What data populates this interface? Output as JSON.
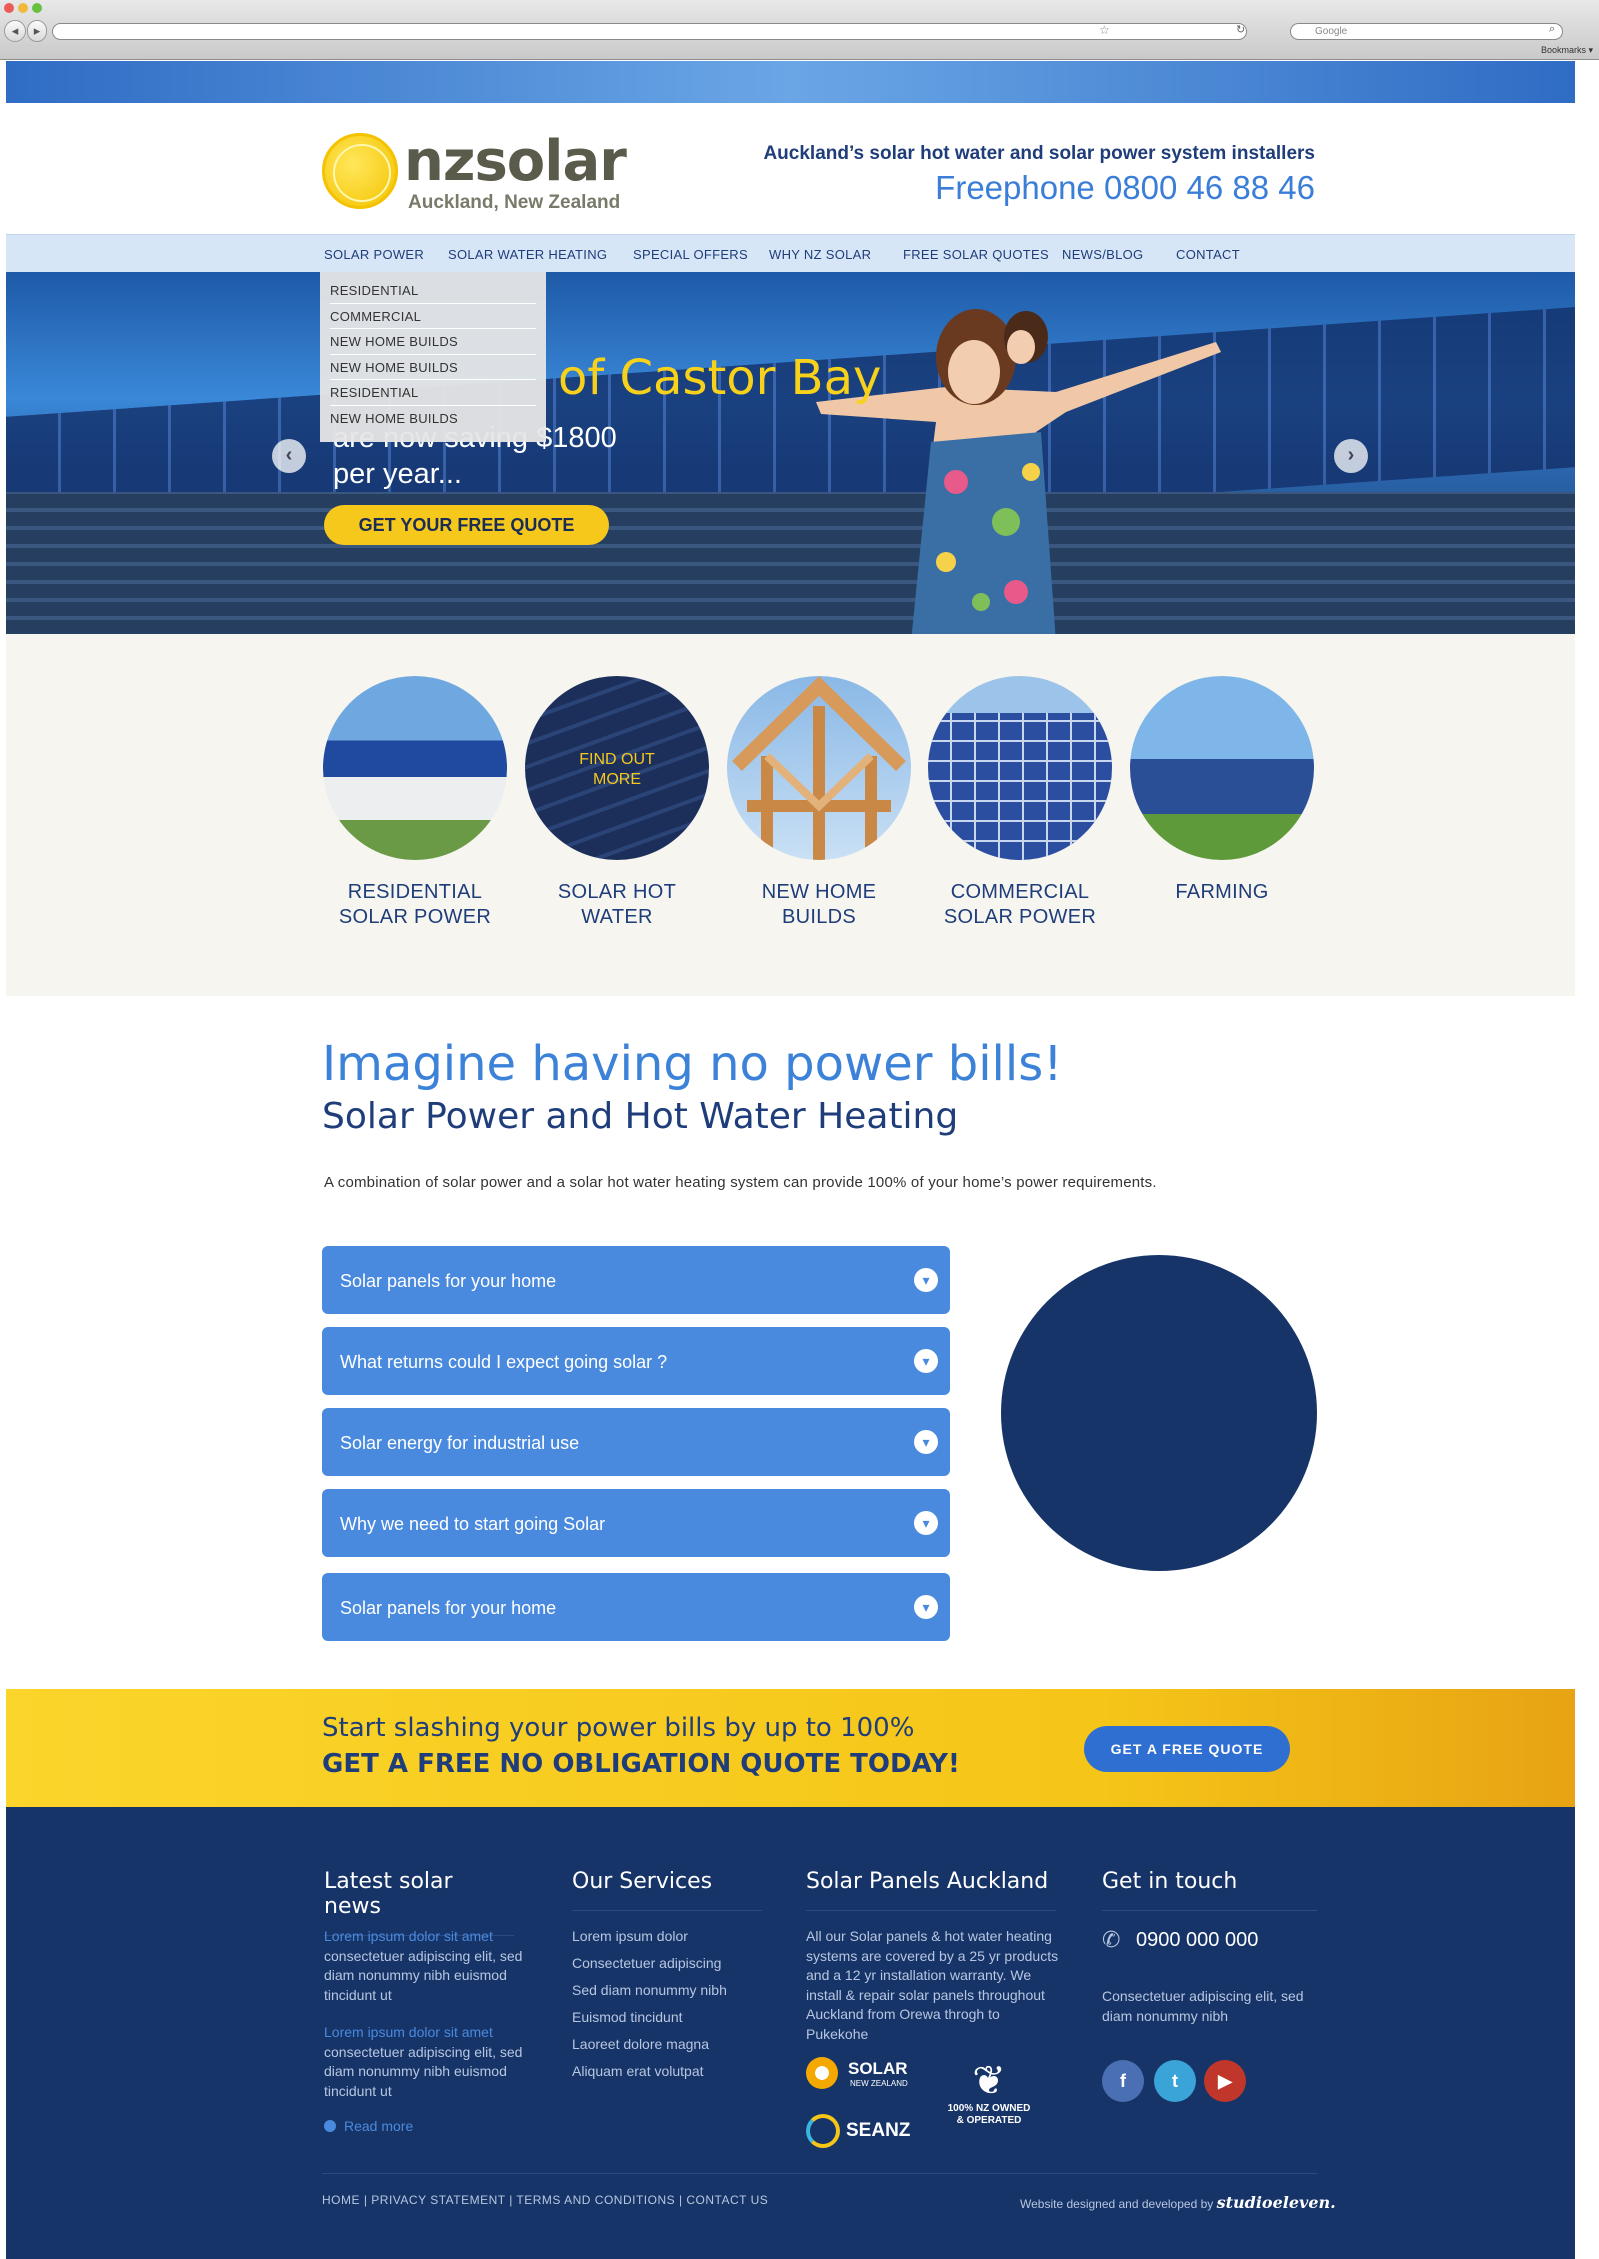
{
  "browser": {
    "url": "",
    "search_placeholder": "Google",
    "bookmarks_label": "Bookmarks"
  },
  "header": {
    "logo_name": "nzsolar",
    "logo_sub": "Auckland, New Zealand",
    "tagline": "Auckland’s solar hot water and solar power system installers",
    "phone": "Freephone 0800 46 88 46"
  },
  "nav": {
    "items": [
      "SOLAR POWER",
      "SOLAR WATER HEATING",
      "SPECIAL OFFERS",
      "WHY NZ SOLAR",
      "FREE SOLAR QUOTES",
      "NEWS/BLOG",
      "CONTACT"
    ],
    "dropdown": [
      "RESIDENTIAL",
      "COMMERCIAL",
      "NEW HOME BUILDS",
      "NEW HOME BUILDS",
      "RESIDENTIAL",
      "NEW HOME BUILDS"
    ]
  },
  "hero": {
    "title": "of Castor Bay",
    "line2": "are now saving $1800",
    "line3": "per year...",
    "button": "GET YOUR FREE QUOTE"
  },
  "categories": [
    {
      "label1": "RESIDENTIAL",
      "label2": "SOLAR POWER"
    },
    {
      "label1": "SOLAR HOT",
      "label2": "WATER",
      "overlay": "FIND OUT MORE"
    },
    {
      "label1": "NEW HOME",
      "label2": "BUILDS"
    },
    {
      "label1": "COMMERCIAL",
      "label2": "SOLAR POWER"
    },
    {
      "label1": "FARMING",
      "label2": ""
    }
  ],
  "main": {
    "heading": "Imagine having no power bills!",
    "subheading": "Solar Power and Hot Water Heating",
    "intro": "A combination of solar power and a solar hot water heating system can provide 100% of your home’s power requirements.",
    "accordion": [
      "Solar panels for your home",
      "What returns could I expect going solar ?",
      "Solar energy for industrial use",
      "Why we need to start going Solar",
      "Solar panels for your home"
    ]
  },
  "cta": {
    "line1": "Start slashing your power bills by up to 100%",
    "line2": "GET A FREE NO OBLIGATION QUOTE TODAY!",
    "button": "GET A FREE QUOTE"
  },
  "footer": {
    "news_title": "Latest solar news",
    "news": [
      {
        "link": "Lorem ipsum dolor sit amet",
        "body": "consectetuer adipiscing elit, sed diam nonummy nibh euismod tincidunt ut"
      },
      {
        "link": "Lorem ipsum dolor sit amet",
        "body": "consectetuer adipiscing elit, sed diam nonummy nibh euismod tincidunt ut"
      }
    ],
    "read_more": "Read more",
    "services_title": "Our Services",
    "services": [
      "Lorem ipsum dolor",
      "Consectetuer adipiscing",
      "Sed diam nonummy nibh",
      "Euismod tincidunt",
      "Laoreet dolore magna",
      "Aliquam erat volutpat"
    ],
    "auckland_title": "Solar Panels Auckland",
    "auckland_text": "All our Solar panels & hot water heating systems are covered by a 25 yr products and a 12 yr installation warranty. We install & repair solar panels throughout Auckland from Orewa throgh to Pukekohe",
    "badges": {
      "solar_nz": "SOLAR",
      "solar_nz_sub": "NEW ZEALAND",
      "seanz": "SEANZ",
      "nz_owned": "100% NZ OWNED & OPERATED"
    },
    "contact_title": "Get in touch",
    "contact_phone": "0900 000 000",
    "contact_text": "Consectetuer adipiscing elit, sed diam nonummy nibh",
    "links": "HOME  |  PRIVACY STATEMENT  |  TERMS AND CONDITIONS  |  CONTACT US",
    "credit": "Website designed and developed by",
    "credit_brand": "studioeleven."
  },
  "colors": {
    "brand_blue": "#3b82d8",
    "navy": "#163468",
    "yellow": "#f6c81c"
  }
}
